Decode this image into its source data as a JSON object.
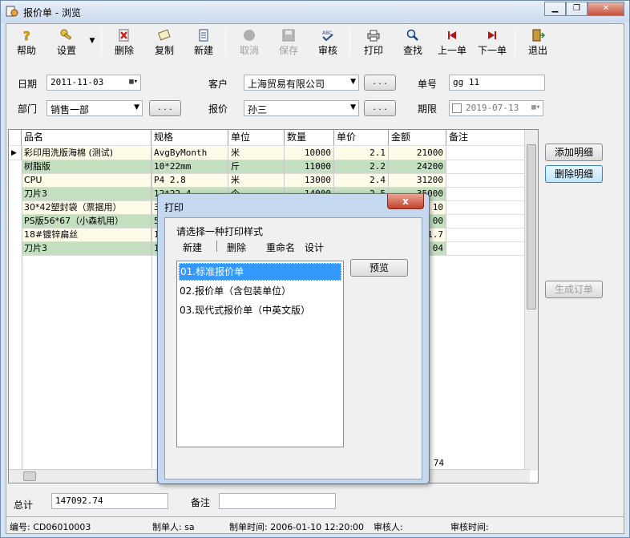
{
  "window": {
    "title": "报价单 - 浏览"
  },
  "toolbar": {
    "help": "帮助",
    "settings": "设置",
    "delete": "删除",
    "copy": "复制",
    "new": "新建",
    "cancel": "取消",
    "save": "保存",
    "audit": "审核",
    "print": "打印",
    "search": "查找",
    "prev": "上一单",
    "next": "下一单",
    "exit": "退出"
  },
  "form": {
    "date_label": "日期",
    "date_value": "2011-11-03",
    "customer_label": "客户",
    "customer_value": "上海贸易有限公司",
    "order_no_label": "单号",
    "order_no_value": "gg  11",
    "dept_label": "部门",
    "dept_value": "销售一部",
    "quoter_label": "报价",
    "quoter_value": "孙三",
    "deadline_label": "期限",
    "deadline_value": "2019-07-13",
    "dots": ". . ."
  },
  "grid": {
    "columns": [
      "品名",
      "规格",
      "单位",
      "数量",
      "单价",
      "金额",
      "备注"
    ],
    "rows": [
      [
        "彩印用洗版海棉 (测试)",
        "AvgByMonth",
        "米",
        "10000",
        "2.1",
        "21000",
        ""
      ],
      [
        "树脂版",
        "10*22mm",
        "斤",
        "11000",
        "2.2",
        "24200",
        ""
      ],
      [
        "CPU",
        "P4 2.8",
        "米",
        "13000",
        "2.4",
        "31200",
        ""
      ],
      [
        "刀片3",
        "12*22.4",
        "个",
        "14000",
        "2.5",
        "35000",
        ""
      ],
      [
        "30*42塑封袋（票据用）",
        "30",
        "",
        "",
        "",
        "10",
        ""
      ],
      [
        "PS版56*67（小森机用）",
        "56",
        "",
        "",
        "",
        "00",
        ""
      ],
      [
        "18#镀锌扁丝",
        "18",
        "",
        "",
        "",
        "1.7",
        ""
      ],
      [
        "刀片3",
        "12",
        "",
        "",
        "",
        "04",
        ""
      ]
    ],
    "total_partial": "74"
  },
  "side": {
    "add": "添加明细",
    "remove": "删除明细",
    "generate": "生成订单"
  },
  "footer": {
    "total_label": "总计",
    "total_value": "147092.74",
    "remark_label": "备注",
    "remark_value": ""
  },
  "status": {
    "code": "编号: CD06010003",
    "maker": "制单人: sa",
    "time": "制单时间: 2006-01-10 12:20:00",
    "auditor": "审核人:",
    "audit_time": "审核时间:"
  },
  "dialog": {
    "title": "打印",
    "prompt": "请选择一种打印样式",
    "new": "新建",
    "delete": "删除",
    "rename": "重命名",
    "design": "设计",
    "preview": "预览",
    "styles": [
      "01.标准报价单",
      "02.报价单（含包装单位）",
      "03.现代式报价单（中英文版）"
    ],
    "close": "x"
  }
}
